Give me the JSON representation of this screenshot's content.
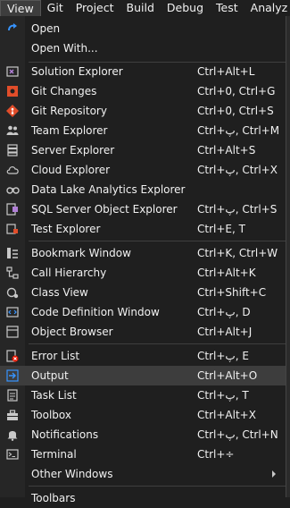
{
  "menubar": {
    "items": [
      "View",
      "Git",
      "Project",
      "Build",
      "Debug",
      "Test",
      "Analyz"
    ]
  },
  "view_menu": {
    "items": [
      {
        "label": "Open",
        "shortcut": "",
        "icon": "open-arrow-icon"
      },
      {
        "label": "Open With...",
        "shortcut": "",
        "icon": ""
      },
      {
        "label": "Solution Explorer",
        "shortcut": "Ctrl+Alt+L",
        "icon": "solution-explorer-icon"
      },
      {
        "label": "Git Changes",
        "shortcut": "Ctrl+0, Ctrl+G",
        "icon": "git-changes-icon"
      },
      {
        "label": "Git Repository",
        "shortcut": "Ctrl+0, Ctrl+S",
        "icon": "git-repository-icon"
      },
      {
        "label": "Team Explorer",
        "shortcut": "Ctrl+پ, Ctrl+M",
        "icon": "team-explorer-icon"
      },
      {
        "label": "Server Explorer",
        "shortcut": "Ctrl+Alt+S",
        "icon": "server-explorer-icon"
      },
      {
        "label": "Cloud Explorer",
        "shortcut": "Ctrl+پ, Ctrl+X",
        "icon": "cloud-icon"
      },
      {
        "label": "Data Lake Analytics Explorer",
        "shortcut": "",
        "icon": "binoculars-icon"
      },
      {
        "label": "SQL Server Object Explorer",
        "shortcut": "Ctrl+پ, Ctrl+S",
        "icon": "sql-server-icon"
      },
      {
        "label": "Test Explorer",
        "shortcut": "Ctrl+E, T",
        "icon": "test-explorer-icon"
      },
      {
        "label": "Bookmark Window",
        "shortcut": "Ctrl+K, Ctrl+W",
        "icon": "bookmark-icon"
      },
      {
        "label": "Call Hierarchy",
        "shortcut": "Ctrl+Alt+K",
        "icon": "call-hierarchy-icon"
      },
      {
        "label": "Class View",
        "shortcut": "Ctrl+Shift+C",
        "icon": "class-view-icon"
      },
      {
        "label": "Code Definition Window",
        "shortcut": "Ctrl+پ, D",
        "icon": "code-definition-icon"
      },
      {
        "label": "Object Browser",
        "shortcut": "Ctrl+Alt+J",
        "icon": "object-browser-icon"
      },
      {
        "label": "Error List",
        "shortcut": "Ctrl+پ, E",
        "icon": "error-list-icon"
      },
      {
        "label": "Output",
        "shortcut": "Ctrl+Alt+O",
        "icon": "output-icon"
      },
      {
        "label": "Task List",
        "shortcut": "Ctrl+پ, T",
        "icon": "task-list-icon"
      },
      {
        "label": "Toolbox",
        "shortcut": "Ctrl+Alt+X",
        "icon": "toolbox-icon"
      },
      {
        "label": "Notifications",
        "shortcut": "Ctrl+پ, Ctrl+N",
        "icon": "bell-icon"
      },
      {
        "label": "Terminal",
        "shortcut": "Ctrl+÷",
        "icon": "terminal-icon"
      },
      {
        "label": "Other Windows",
        "shortcut": "",
        "icon": "submenu-arrow-icon"
      },
      {
        "label": "Toolbars",
        "shortcut": "",
        "icon": ""
      }
    ]
  },
  "colors": {
    "background": "#1f1f1f",
    "highlight": "#3d3d3d",
    "text": "#f1f1f1",
    "accent_blue": "#3794ff",
    "git_red": "#e14d2a"
  }
}
